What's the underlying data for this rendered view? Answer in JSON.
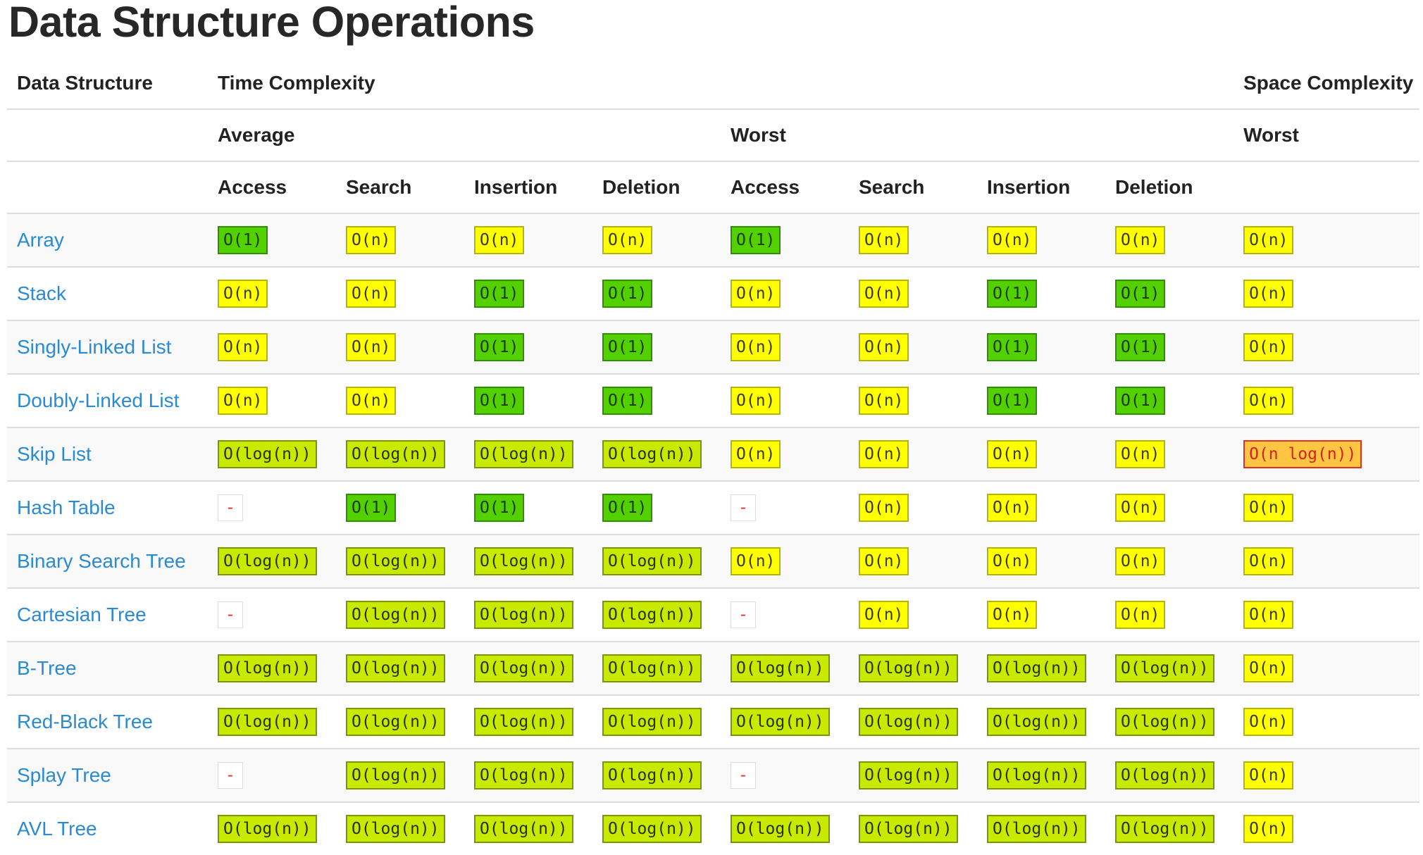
{
  "page": {
    "title": "Data Structure Operations"
  },
  "colors": {
    "green": "#53d000",
    "lime": "#c8ea00",
    "yellow": "#ffff00",
    "orange": "#ffc543",
    "link": "#2a8ad4"
  },
  "header": {
    "data_structure": "Data Structure",
    "time_complexity": "Time Complexity",
    "space_complexity": "Space Complexity",
    "average": "Average",
    "worst": "Worst",
    "space_worst": "Worst",
    "columns": [
      "Access",
      "Search",
      "Insertion",
      "Deletion",
      "Access",
      "Search",
      "Insertion",
      "Deletion"
    ]
  },
  "rows": [
    {
      "name": "Array",
      "cells": [
        {
          "t": "O(1)",
          "c": "green"
        },
        {
          "t": "O(n)",
          "c": "yellow"
        },
        {
          "t": "O(n)",
          "c": "yellow"
        },
        {
          "t": "O(n)",
          "c": "yellow"
        },
        {
          "t": "O(1)",
          "c": "green"
        },
        {
          "t": "O(n)",
          "c": "yellow"
        },
        {
          "t": "O(n)",
          "c": "yellow"
        },
        {
          "t": "O(n)",
          "c": "yellow"
        },
        {
          "t": "O(n)",
          "c": "yellow"
        }
      ]
    },
    {
      "name": "Stack",
      "cells": [
        {
          "t": "O(n)",
          "c": "yellow"
        },
        {
          "t": "O(n)",
          "c": "yellow"
        },
        {
          "t": "O(1)",
          "c": "green"
        },
        {
          "t": "O(1)",
          "c": "green"
        },
        {
          "t": "O(n)",
          "c": "yellow"
        },
        {
          "t": "O(n)",
          "c": "yellow"
        },
        {
          "t": "O(1)",
          "c": "green"
        },
        {
          "t": "O(1)",
          "c": "green"
        },
        {
          "t": "O(n)",
          "c": "yellow"
        }
      ]
    },
    {
      "name": "Singly-Linked List",
      "cells": [
        {
          "t": "O(n)",
          "c": "yellow"
        },
        {
          "t": "O(n)",
          "c": "yellow"
        },
        {
          "t": "O(1)",
          "c": "green"
        },
        {
          "t": "O(1)",
          "c": "green"
        },
        {
          "t": "O(n)",
          "c": "yellow"
        },
        {
          "t": "O(n)",
          "c": "yellow"
        },
        {
          "t": "O(1)",
          "c": "green"
        },
        {
          "t": "O(1)",
          "c": "green"
        },
        {
          "t": "O(n)",
          "c": "yellow"
        }
      ]
    },
    {
      "name": "Doubly-Linked List",
      "cells": [
        {
          "t": "O(n)",
          "c": "yellow"
        },
        {
          "t": "O(n)",
          "c": "yellow"
        },
        {
          "t": "O(1)",
          "c": "green"
        },
        {
          "t": "O(1)",
          "c": "green"
        },
        {
          "t": "O(n)",
          "c": "yellow"
        },
        {
          "t": "O(n)",
          "c": "yellow"
        },
        {
          "t": "O(1)",
          "c": "green"
        },
        {
          "t": "O(1)",
          "c": "green"
        },
        {
          "t": "O(n)",
          "c": "yellow"
        }
      ]
    },
    {
      "name": "Skip List",
      "cells": [
        {
          "t": "O(log(n))",
          "c": "lime"
        },
        {
          "t": "O(log(n))",
          "c": "lime"
        },
        {
          "t": "O(log(n))",
          "c": "lime"
        },
        {
          "t": "O(log(n))",
          "c": "lime"
        },
        {
          "t": "O(n)",
          "c": "yellow"
        },
        {
          "t": "O(n)",
          "c": "yellow"
        },
        {
          "t": "O(n)",
          "c": "yellow"
        },
        {
          "t": "O(n)",
          "c": "yellow"
        },
        {
          "t": "O(n log(n))",
          "c": "orange"
        }
      ]
    },
    {
      "name": "Hash Table",
      "cells": [
        {
          "t": "-",
          "c": "none"
        },
        {
          "t": "O(1)",
          "c": "green"
        },
        {
          "t": "O(1)",
          "c": "green"
        },
        {
          "t": "O(1)",
          "c": "green"
        },
        {
          "t": "-",
          "c": "none"
        },
        {
          "t": "O(n)",
          "c": "yellow"
        },
        {
          "t": "O(n)",
          "c": "yellow"
        },
        {
          "t": "O(n)",
          "c": "yellow"
        },
        {
          "t": "O(n)",
          "c": "yellow"
        }
      ]
    },
    {
      "name": "Binary Search Tree",
      "cells": [
        {
          "t": "O(log(n))",
          "c": "lime"
        },
        {
          "t": "O(log(n))",
          "c": "lime"
        },
        {
          "t": "O(log(n))",
          "c": "lime"
        },
        {
          "t": "O(log(n))",
          "c": "lime"
        },
        {
          "t": "O(n)",
          "c": "yellow"
        },
        {
          "t": "O(n)",
          "c": "yellow"
        },
        {
          "t": "O(n)",
          "c": "yellow"
        },
        {
          "t": "O(n)",
          "c": "yellow"
        },
        {
          "t": "O(n)",
          "c": "yellow"
        }
      ]
    },
    {
      "name": "Cartesian Tree",
      "cells": [
        {
          "t": "-",
          "c": "none"
        },
        {
          "t": "O(log(n))",
          "c": "lime"
        },
        {
          "t": "O(log(n))",
          "c": "lime"
        },
        {
          "t": "O(log(n))",
          "c": "lime"
        },
        {
          "t": "-",
          "c": "none"
        },
        {
          "t": "O(n)",
          "c": "yellow"
        },
        {
          "t": "O(n)",
          "c": "yellow"
        },
        {
          "t": "O(n)",
          "c": "yellow"
        },
        {
          "t": "O(n)",
          "c": "yellow"
        }
      ]
    },
    {
      "name": "B-Tree",
      "cells": [
        {
          "t": "O(log(n))",
          "c": "lime"
        },
        {
          "t": "O(log(n))",
          "c": "lime"
        },
        {
          "t": "O(log(n))",
          "c": "lime"
        },
        {
          "t": "O(log(n))",
          "c": "lime"
        },
        {
          "t": "O(log(n))",
          "c": "lime"
        },
        {
          "t": "O(log(n))",
          "c": "lime"
        },
        {
          "t": "O(log(n))",
          "c": "lime"
        },
        {
          "t": "O(log(n))",
          "c": "lime"
        },
        {
          "t": "O(n)",
          "c": "yellow"
        }
      ]
    },
    {
      "name": "Red-Black Tree",
      "cells": [
        {
          "t": "O(log(n))",
          "c": "lime"
        },
        {
          "t": "O(log(n))",
          "c": "lime"
        },
        {
          "t": "O(log(n))",
          "c": "lime"
        },
        {
          "t": "O(log(n))",
          "c": "lime"
        },
        {
          "t": "O(log(n))",
          "c": "lime"
        },
        {
          "t": "O(log(n))",
          "c": "lime"
        },
        {
          "t": "O(log(n))",
          "c": "lime"
        },
        {
          "t": "O(log(n))",
          "c": "lime"
        },
        {
          "t": "O(n)",
          "c": "yellow"
        }
      ]
    },
    {
      "name": "Splay Tree",
      "cells": [
        {
          "t": "-",
          "c": "none"
        },
        {
          "t": "O(log(n))",
          "c": "lime"
        },
        {
          "t": "O(log(n))",
          "c": "lime"
        },
        {
          "t": "O(log(n))",
          "c": "lime"
        },
        {
          "t": "-",
          "c": "none"
        },
        {
          "t": "O(log(n))",
          "c": "lime"
        },
        {
          "t": "O(log(n))",
          "c": "lime"
        },
        {
          "t": "O(log(n))",
          "c": "lime"
        },
        {
          "t": "O(n)",
          "c": "yellow"
        }
      ]
    },
    {
      "name": "AVL Tree",
      "cells": [
        {
          "t": "O(log(n))",
          "c": "lime"
        },
        {
          "t": "O(log(n))",
          "c": "lime"
        },
        {
          "t": "O(log(n))",
          "c": "lime"
        },
        {
          "t": "O(log(n))",
          "c": "lime"
        },
        {
          "t": "O(log(n))",
          "c": "lime"
        },
        {
          "t": "O(log(n))",
          "c": "lime"
        },
        {
          "t": "O(log(n))",
          "c": "lime"
        },
        {
          "t": "O(log(n))",
          "c": "lime"
        },
        {
          "t": "O(n)",
          "c": "yellow"
        }
      ]
    }
  ]
}
